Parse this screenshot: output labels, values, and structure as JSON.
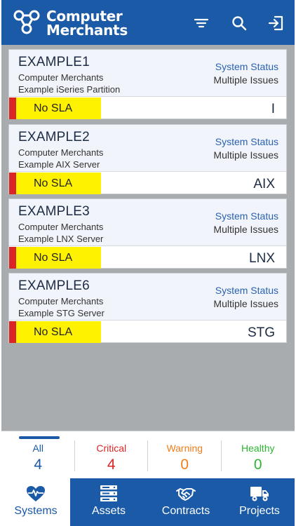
{
  "header": {
    "brand_line1": "Computer",
    "brand_line2": "Merchants"
  },
  "assets": [
    {
      "name": "EXAMPLE1",
      "company": "Computer Merchants",
      "description": "Example iSeries Partition",
      "status_label": "System Status",
      "status_value": "Multiple Issues",
      "sla": "No SLA",
      "os": "I"
    },
    {
      "name": "EXAMPLE2",
      "company": "Computer Merchants",
      "description": "Example AIX Server",
      "status_label": "System Status",
      "status_value": "Multiple Issues",
      "sla": "No SLA",
      "os": "AIX"
    },
    {
      "name": "EXAMPLE3",
      "company": "Computer Merchants",
      "description": "Example LNX Server",
      "status_label": "System Status",
      "status_value": "Multiple Issues",
      "sla": "No SLA",
      "os": "LNX"
    },
    {
      "name": "EXAMPLE6",
      "company": "Computer Merchants",
      "description": "Example STG Server",
      "status_label": "System Status",
      "status_value": "Multiple Issues",
      "sla": "No SLA",
      "os": "STG"
    }
  ],
  "filters": [
    {
      "label": "All",
      "count": "4",
      "color": "#1a5aa6",
      "active": true
    },
    {
      "label": "Critical",
      "count": "4",
      "color": "#d92525",
      "active": false
    },
    {
      "label": "Warning",
      "count": "0",
      "color": "#f07d1a",
      "active": false
    },
    {
      "label": "Healthy",
      "count": "0",
      "color": "#2bb534",
      "active": false
    }
  ],
  "nav": [
    {
      "label": "Systems",
      "icon": "heart-pulse-icon",
      "active": true
    },
    {
      "label": "Assets",
      "icon": "server-rack-icon",
      "active": false
    },
    {
      "label": "Contracts",
      "icon": "handshake-icon",
      "active": false
    },
    {
      "label": "Projects",
      "icon": "truck-icon",
      "active": false
    }
  ],
  "colors": {
    "brand": "#1a5aa6",
    "sla_highlight": "#fff200",
    "sla_strip": "#d92525"
  }
}
